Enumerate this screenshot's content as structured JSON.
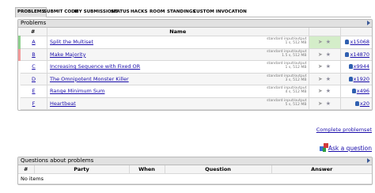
{
  "nav": [
    "PROBLEMS",
    "SUBMIT CODE",
    "MY SUBMISSIONS",
    "STATUS",
    "HACKS",
    "ROOM",
    "STANDINGS",
    "CUSTOM INVOCATION"
  ],
  "problems_panel": {
    "title": "Problems",
    "headers": {
      "idx": "#",
      "name": "Name"
    },
    "rows": [
      {
        "idx": "A",
        "name": "Split the Multiset",
        "io": "standard input/output",
        "limits": "1 s, 512 MB",
        "solved": "x15068",
        "status": "g"
      },
      {
        "idx": "B",
        "name": "Make Majority",
        "io": "standard input/output",
        "limits": "1.5 s, 512 MB",
        "solved": "x14870",
        "status": "r"
      },
      {
        "idx": "C",
        "name": "Increasing Sequence with Fixed OR",
        "io": "standard input/output",
        "limits": "1 s, 512 MB",
        "solved": "x9944",
        "status": "n"
      },
      {
        "idx": "D",
        "name": "The Omnipotent Monster Killer",
        "io": "standard input/output",
        "limits": "3 s, 512 MB",
        "solved": "x1920",
        "status": "n"
      },
      {
        "idx": "E",
        "name": "Range Minimum Sum",
        "io": "standard input/output",
        "limits": "4 s, 512 MB",
        "solved": "x496",
        "status": "n"
      },
      {
        "idx": "F",
        "name": "Heartbeat",
        "io": "standard input/output",
        "limits": "5 s, 512 MB",
        "solved": "x20",
        "status": "n"
      }
    ]
  },
  "complete_problemset": "Complete problemset",
  "ask_question": "Ask a question",
  "questions_panel": {
    "title": "Questions about problems",
    "headers": {
      "idx": "#",
      "party": "Party",
      "when": "When",
      "question": "Question",
      "answer": "Answer"
    },
    "empty": "No items"
  }
}
